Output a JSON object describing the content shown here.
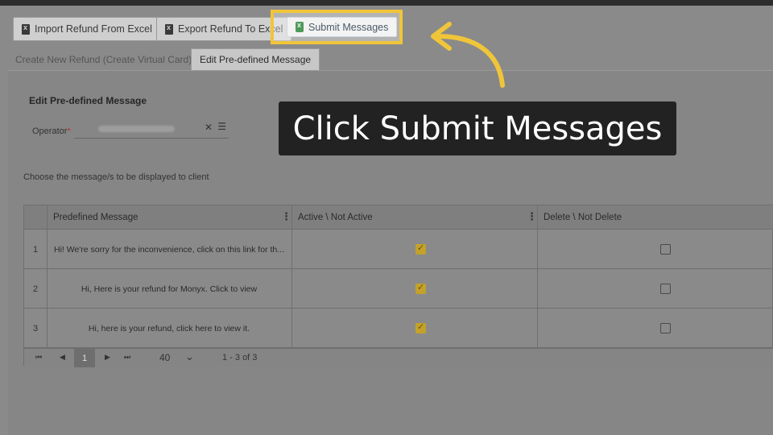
{
  "toolbar": {
    "import_label": "Import Refund From Excel",
    "export_label": "Export Refund To Excel",
    "submit_label": "Submit Messages"
  },
  "tabs": [
    {
      "label": "Create New Refund (Create Virtual Card)"
    },
    {
      "label": "Edit Pre-defined Message"
    }
  ],
  "form": {
    "section_title": "Edit Pre-defined Message",
    "operator_label": "Operator",
    "operator_required": "*",
    "clear_icon": "✕",
    "list_icon": "☰",
    "choose_text": "Choose the message/s to be displayed to client"
  },
  "grid": {
    "columns": [
      {
        "label": "Predefined Message"
      },
      {
        "label": "Active \\ Not Active"
      },
      {
        "label": "Delete \\ Not Delete"
      }
    ],
    "rows": [
      {
        "num": "1",
        "message": "Hi! We're sorry for the inconvenience, click on this link for th...",
        "active": true,
        "delete": false
      },
      {
        "num": "2",
        "message": "Hi, Here is your refund for Monyx. Click to view",
        "active": true,
        "delete": false
      },
      {
        "num": "3",
        "message": "Hi, here is your refund, click here to view it.",
        "active": true,
        "delete": false
      }
    ],
    "pager": {
      "first": "⏮",
      "prev": "◀",
      "current_page": "1",
      "next": "▶",
      "last": "⏭",
      "page_size": "40",
      "range_info": "1 - 3 of 3"
    }
  },
  "callout": {
    "text": "Click Submit Messages"
  },
  "colors": {
    "highlight": "#f0c53a",
    "callout_bg": "#222222",
    "checkbox_active": "#c4a12a"
  }
}
